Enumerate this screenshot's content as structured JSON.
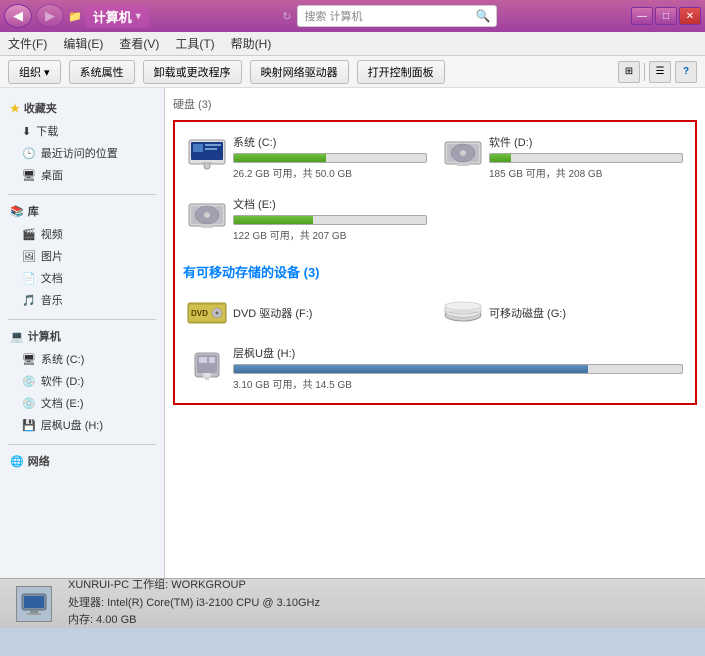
{
  "titlebar": {
    "title": "计算机",
    "min_label": "—",
    "max_label": "□",
    "close_label": "✕"
  },
  "addressbar": {
    "path": "计算机",
    "search_placeholder": "搜索 计算机"
  },
  "menubar": {
    "items": [
      "文件(F)",
      "编辑(E)",
      "查看(V)",
      "工具(T)",
      "帮助(H)"
    ]
  },
  "toolbar": {
    "items": [
      "组织 ▾",
      "系统属性",
      "卸载或更改程序",
      "映射网络驱动器",
      "打开控制面板"
    ],
    "help_label": "?"
  },
  "sidebar": {
    "favorites_label": "收藏夹",
    "favorites": [
      {
        "label": "下载",
        "icon": "download"
      },
      {
        "label": "最近访问的位置",
        "icon": "recent"
      },
      {
        "label": "桌面",
        "icon": "desktop"
      }
    ],
    "library_label": "库",
    "library": [
      {
        "label": "视频",
        "icon": "video"
      },
      {
        "label": "图片",
        "icon": "picture"
      },
      {
        "label": "文档",
        "icon": "document"
      },
      {
        "label": "音乐",
        "icon": "music"
      }
    ],
    "computer_label": "计算机",
    "computer": [
      {
        "label": "系统 (C:)",
        "icon": "drive_c"
      },
      {
        "label": "软件 (D:)",
        "icon": "drive_d"
      },
      {
        "label": "文档 (E:)",
        "icon": "drive_e"
      },
      {
        "label": "层枫U盘 (H:)",
        "icon": "drive_h"
      }
    ],
    "network_label": "网络"
  },
  "content": {
    "hard_disk_title": "硬盘 (3)",
    "drives": [
      {
        "name": "系统 (C:)",
        "free": "26.2 GB 可用，共 50.0 GB",
        "bar_pct": 48,
        "bar_type": "normal"
      },
      {
        "name": "软件 (D:)",
        "free": "185 GB 可用，共 208 GB",
        "bar_pct": 11,
        "bar_type": "normal"
      },
      {
        "name": "文档 (E:)",
        "free": "122 GB 可用，共 207 GB",
        "bar_pct": 41,
        "bar_type": "normal"
      }
    ],
    "removable_title": "有可移动存储的设备 (3)",
    "removable": [
      {
        "name": "DVD 驱动器 (F:)",
        "type": "dvd"
      },
      {
        "name": "可移动磁盘 (G:)",
        "type": "removable"
      }
    ],
    "udisk": {
      "name": "层枫U盘 (H:)",
      "free": "3.10 GB 可用，共 14.5 GB",
      "bar_pct": 79,
      "bar_type": "blue"
    }
  },
  "statusbar": {
    "machine": "XUNRUI-PC  工作组: WORKGROUP",
    "cpu": "处理器: Intel(R) Core(TM) i3-2100 CPU @ 3.10GHz",
    "ram": "内存: 4.00 GB"
  }
}
